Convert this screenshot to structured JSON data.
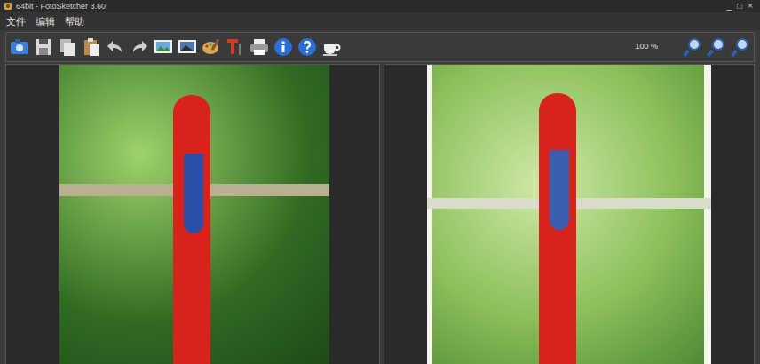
{
  "window": {
    "title": "64bit - FotoSketcher 3.60",
    "controls": [
      "_",
      "□",
      "×"
    ]
  },
  "menu": [
    "文件",
    "编辑",
    "帮助"
  ],
  "toolbar": {
    "zoom": "100 %"
  }
}
